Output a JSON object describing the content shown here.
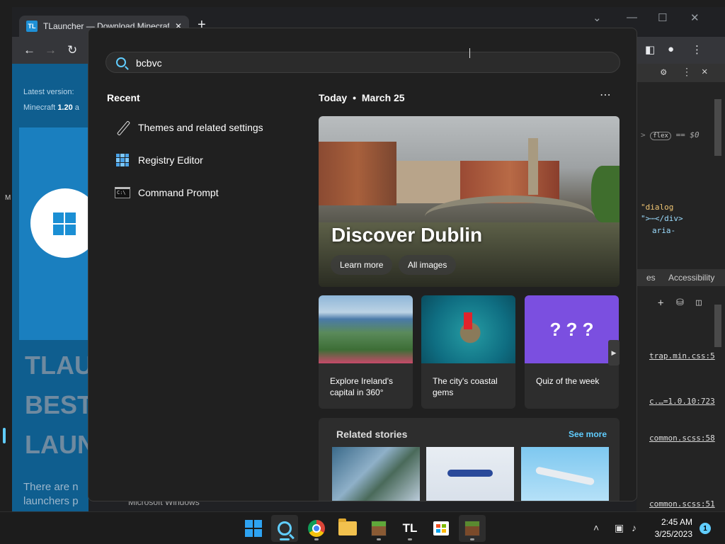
{
  "browser": {
    "tab_title": "TLauncher — Download Minecraft",
    "tab_icon_text": "TL",
    "new_tab_symbol": "+",
    "page": {
      "latest_label": "Latest version:",
      "mc_label": "Minecraft",
      "mc_version": "1.20",
      "mc_suffix": "a",
      "heading_lines": [
        "TLAU",
        "BEST",
        "LAUN"
      ],
      "body_text": "There are n",
      "body_text2": "launchers p"
    },
    "devtools": {
      "code1": "flex",
      "code1_suffix": "== $0",
      "code2": "\"dialog",
      "code3": "\">⋯</div>",
      "code4": "aria-",
      "tab_partial": "es",
      "tab_accessibility": "Accessibility",
      "links": [
        "trap.min.css:5",
        "c.…=1.0.10:723",
        "common.scss:58",
        "common.scss:51"
      ]
    },
    "bottom_text": "Microsoft Windows",
    "left_edge_text": "M"
  },
  "search": {
    "query": "bcbvc",
    "recent_title": "Recent",
    "recent": [
      {
        "label": "Themes and related settings",
        "icon": "brush-icon"
      },
      {
        "label": "Registry Editor",
        "icon": "registry-icon"
      },
      {
        "label": "Command Prompt",
        "icon": "cmd-icon"
      }
    ],
    "today_label": "Today",
    "today_sep": "•",
    "today_date": "March 25",
    "more_symbol": "⋯",
    "hero": {
      "title": "Discover Dublin",
      "learn_more": "Learn more",
      "all_images": "All images"
    },
    "cards": [
      {
        "caption": "Explore Ireland's capital in 360°"
      },
      {
        "caption": "The city's coastal gems"
      },
      {
        "caption": "Quiz of the week"
      }
    ],
    "card_next_symbol": "▶",
    "related": {
      "title": "Related stories",
      "see_more": "See more"
    }
  },
  "taskbar": {
    "clock_time": "2:45 AM",
    "clock_date": "3/25/2023",
    "notification_count": "1",
    "tl_label": "TL",
    "tray_chevron": "˄",
    "tray_network": "▣",
    "tray_volume": "♪"
  },
  "colors": {
    "accent": "#60cdff",
    "flyout_bg": "#202020",
    "card_bg": "#2d2d2d"
  }
}
